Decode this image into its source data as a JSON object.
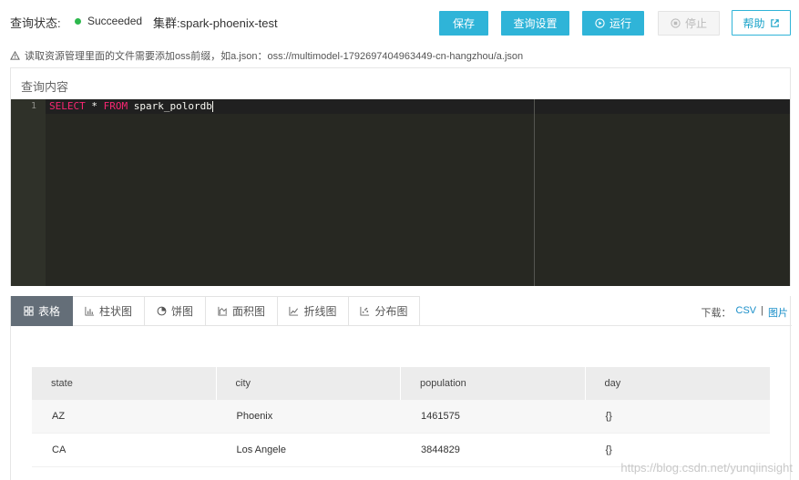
{
  "header": {
    "status_label": "查询状态:",
    "status_value": "Succeeded",
    "cluster": "集群:spark-phoenix-test",
    "status_color": "#2db84d"
  },
  "toolbar": {
    "save": "保存",
    "query_settings": "查询设置",
    "run": "运行",
    "stop": "停止",
    "help": "帮助"
  },
  "notice": "读取资源管理里面的文件需要添加oss前缀，如a.json：oss://multimodel-1792697404963449-cn-hangzhou/a.json",
  "query": {
    "title": "查询内容",
    "line_number": "1",
    "kw_select": "SELECT",
    "star": " * ",
    "kw_from": "FROM",
    "table_name": " spark_polordb"
  },
  "tabs": [
    {
      "label": "表格",
      "icon": "table-grid-icon"
    },
    {
      "label": "柱状图",
      "icon": "bar-chart-icon"
    },
    {
      "label": "饼图",
      "icon": "pie-chart-icon"
    },
    {
      "label": "面积图",
      "icon": "area-chart-icon"
    },
    {
      "label": "折线图",
      "icon": "line-chart-icon"
    },
    {
      "label": "分布图",
      "icon": "scatter-chart-icon"
    }
  ],
  "download": {
    "label": "下载：",
    "csv": "CSV",
    "separator": "|",
    "image": "图片"
  },
  "table": {
    "columns": [
      "state",
      "city",
      "population",
      "day"
    ],
    "rows": [
      [
        "AZ",
        "Phoenix",
        "1461575",
        "{}"
      ],
      [
        "CA",
        "Los Angele",
        "3844829",
        "{}"
      ]
    ]
  },
  "watermark": "https://blog.csdn.net/yunqiinsight"
}
